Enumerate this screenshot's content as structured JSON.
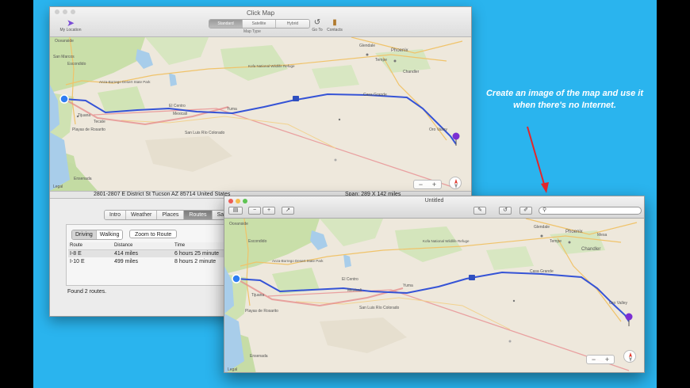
{
  "window1": {
    "title": "Click Map",
    "toolbar": {
      "my_location": "My Location",
      "map_types": [
        "Standard",
        "Satellite",
        "Hybrid"
      ],
      "map_type_caption": "Map Type",
      "go_to": "Go To",
      "contacts": "Contacts"
    },
    "address": "2801-2807 E District St Tucson AZ 85714 United States",
    "span": "Span: 289 X 142 miles",
    "tabs": [
      "Intro",
      "Weather",
      "Places",
      "Routes",
      "Sa"
    ],
    "route_modes": [
      "Driving",
      "Walking"
    ],
    "zoom_to_route": "Zoom to Route",
    "table_headers": [
      "Route",
      "Distance",
      "Time"
    ],
    "routes": [
      {
        "route": "I-8 E",
        "distance": "414 miles",
        "time": "6 hours 25 minute"
      },
      {
        "route": "I-10 E",
        "distance": "499 miles",
        "time": "8 hours 2 minute"
      }
    ],
    "found": "Found 2 routes."
  },
  "window2": {
    "title": "Untitled"
  },
  "map": {
    "labels": {
      "phoenix": "Phoenix",
      "glendale": "Glendale",
      "tempe": "Tempe",
      "chandler": "Chandler",
      "mesa": "Mesa",
      "kofa": "Kofa National Wildlife Refuge",
      "anza": "Anza-Borrego Desert State Park",
      "el_centro": "El Centro",
      "mexicali": "Mexicali",
      "yuma": "Yuma",
      "san_luis": "San Luis Río Colorado",
      "casa_grande": "Casa Grande",
      "tijuana": "Tijuana",
      "playas": "Playas de Rosarito",
      "ensenada": "Ensenada",
      "escondido": "Escondido",
      "san_marcos": "San Marcos",
      "oceanside": "Oceanside",
      "tecate": "Tecate",
      "oro_valley": "Oro Valley",
      "legal": "Legal",
      "interstate": "8"
    },
    "route_color": "#3553d6",
    "alt_route_color": "#e58a8a"
  },
  "annotation": "Create an image of the map and use it when there's no Internet."
}
